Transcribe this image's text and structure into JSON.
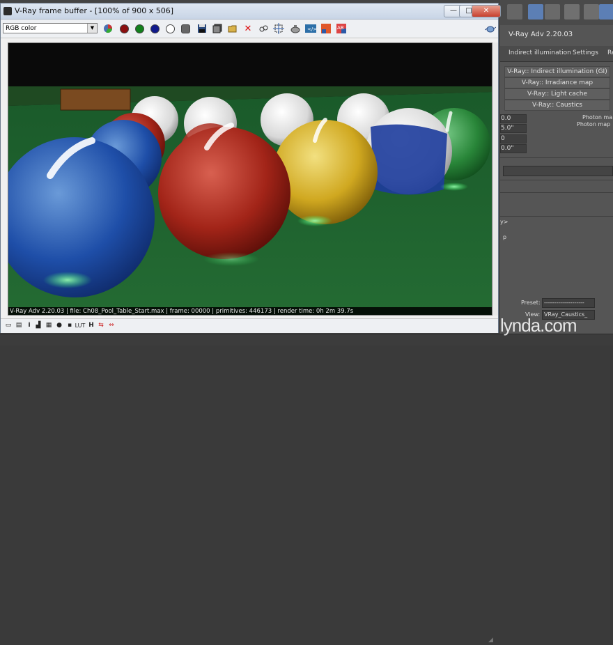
{
  "window": {
    "title": "V-Ray frame buffer - [100% of 900 x 506]",
    "minimize": "—",
    "maximize": "□",
    "close": "✕"
  },
  "toolbar": {
    "channel": "RGB color",
    "buttons": [
      "color-wheel-icon",
      "red-channel-icon",
      "green-channel-icon",
      "blue-channel-icon",
      "alpha-channel-icon",
      "mono-icon",
      "save-icon",
      "save-all-icon",
      "open-icon",
      "clear-icon",
      "track-mouse-icon",
      "region-render-icon",
      "render-last-icon",
      "lut-icon",
      "pixel-info-icon",
      "vfb-history-icon",
      "teapot-icon"
    ]
  },
  "render": {
    "info": "V-Ray Adv 2.20.03 | file: Ch08_Pool_Table_Start.max | frame: 00000 | primitives: 446173 | render time:  0h  2m 39.7s"
  },
  "bottombar": {
    "buttons": [
      "show-corrections-icon",
      "levels-icon",
      "info-icon",
      "color-curve-icon",
      "exposure-icon",
      "histogram-icon",
      "lut-small-icon",
      "hd-icon",
      "bg-icon",
      "history-icon"
    ]
  },
  "background_ui": {
    "panel_title": "V-Ray Adv 2.20.03",
    "tabs": [
      "Indirect illumination",
      "Settings",
      "Re"
    ],
    "rollouts": [
      "V-Ray:: Indirect illumination (GI)",
      "V-Ray:: Irradiance map",
      "V-Ray:: Light cache",
      "V-Ray:: Caustics"
    ],
    "spinners": [
      "0.0",
      "5.0\"",
      "0",
      "0.0\""
    ],
    "photon_label_1": "Photon ma",
    "photon_label_2": "Photon map",
    "misc_1": "y>",
    "misc_2": "p",
    "preset_label": "Preset:",
    "preset_value": "--------------------",
    "view_label": "View:",
    "view_value": "VRay_Caustics_"
  },
  "watermark": "lynda.com",
  "colors": {
    "felt": "#1e6b34",
    "rail": "#2a5c2a",
    "titlebar": "#cfd9e8"
  }
}
